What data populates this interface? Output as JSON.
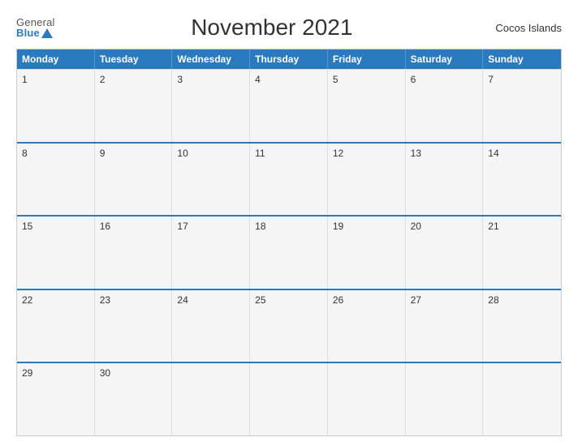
{
  "header": {
    "logo_general": "General",
    "logo_blue": "Blue",
    "title": "November 2021",
    "region": "Cocos Islands"
  },
  "calendar": {
    "weekdays": [
      "Monday",
      "Tuesday",
      "Wednesday",
      "Thursday",
      "Friday",
      "Saturday",
      "Sunday"
    ],
    "weeks": [
      [
        {
          "day": "1",
          "empty": false
        },
        {
          "day": "2",
          "empty": false
        },
        {
          "day": "3",
          "empty": false
        },
        {
          "day": "4",
          "empty": false
        },
        {
          "day": "5",
          "empty": false
        },
        {
          "day": "6",
          "empty": false
        },
        {
          "day": "7",
          "empty": false
        }
      ],
      [
        {
          "day": "8",
          "empty": false
        },
        {
          "day": "9",
          "empty": false
        },
        {
          "day": "10",
          "empty": false
        },
        {
          "day": "11",
          "empty": false
        },
        {
          "day": "12",
          "empty": false
        },
        {
          "day": "13",
          "empty": false
        },
        {
          "day": "14",
          "empty": false
        }
      ],
      [
        {
          "day": "15",
          "empty": false
        },
        {
          "day": "16",
          "empty": false
        },
        {
          "day": "17",
          "empty": false
        },
        {
          "day": "18",
          "empty": false
        },
        {
          "day": "19",
          "empty": false
        },
        {
          "day": "20",
          "empty": false
        },
        {
          "day": "21",
          "empty": false
        }
      ],
      [
        {
          "day": "22",
          "empty": false
        },
        {
          "day": "23",
          "empty": false
        },
        {
          "day": "24",
          "empty": false
        },
        {
          "day": "25",
          "empty": false
        },
        {
          "day": "26",
          "empty": false
        },
        {
          "day": "27",
          "empty": false
        },
        {
          "day": "28",
          "empty": false
        }
      ],
      [
        {
          "day": "29",
          "empty": false
        },
        {
          "day": "30",
          "empty": false
        },
        {
          "day": "",
          "empty": true
        },
        {
          "day": "",
          "empty": true
        },
        {
          "day": "",
          "empty": true
        },
        {
          "day": "",
          "empty": true
        },
        {
          "day": "",
          "empty": true
        }
      ]
    ]
  }
}
